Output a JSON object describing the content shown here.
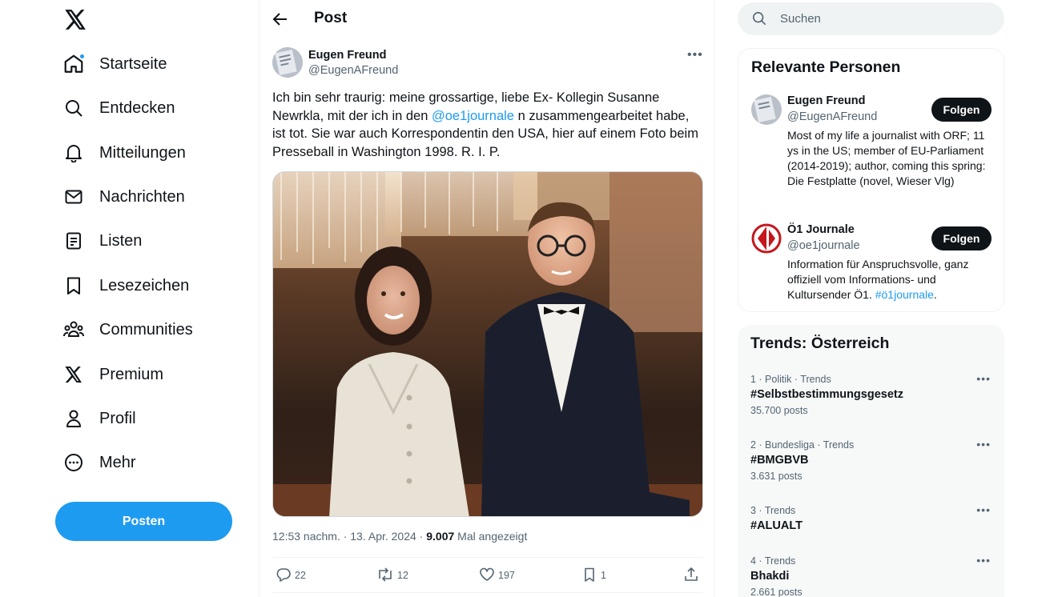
{
  "nav": {
    "items": [
      {
        "label": "Startseite",
        "icon": "home-icon"
      },
      {
        "label": "Entdecken",
        "icon": "search-icon"
      },
      {
        "label": "Mitteilungen",
        "icon": "bell-icon"
      },
      {
        "label": "Nachrichten",
        "icon": "mail-icon"
      },
      {
        "label": "Listen",
        "icon": "list-icon"
      },
      {
        "label": "Lesezeichen",
        "icon": "bookmark-icon"
      },
      {
        "label": "Communities",
        "icon": "people-icon"
      },
      {
        "label": "Premium",
        "icon": "x-logo-icon"
      },
      {
        "label": "Profil",
        "icon": "person-icon"
      },
      {
        "label": "Mehr",
        "icon": "more-circle-icon"
      }
    ],
    "post_button": "Posten"
  },
  "header": {
    "title": "Post"
  },
  "post": {
    "author_name": "Eugen Freund",
    "author_handle": "@EugenAFreund",
    "text_before": "Ich bin sehr traurig: meine grossartige, liebe Ex- Kollegin Susanne Newrkla, mit der ich in den ",
    "mention": "@oe1journale",
    "text_after": " n zusammengearbeitet habe, ist tot. Sie war auch Korrespondentin den USA, hier auf einem Foto beim Presseball in Washington 1998. R. I. P.",
    "time": "12:53 nachm. · 13. Apr. 2024 · ",
    "views": "9.007",
    "views_label": " Mal angezeigt",
    "replies": "22",
    "reposts": "12",
    "likes": "197",
    "bookmarks": "1"
  },
  "search": {
    "placeholder": "Suchen"
  },
  "relevant": {
    "title": "Relevante Personen",
    "people": [
      {
        "name": "Eugen Freund",
        "handle": "@EugenAFreund",
        "bio": "Most of my life a journalist with ORF; 11 ys in the US; member of EU-Parliament (2014-2019); author, coming this spring: Die Festplatte (novel, Wieser Vlg)",
        "follow": "Folgen"
      },
      {
        "name": "Ö1 Journale",
        "handle": "@oe1journale",
        "bio_before": "Information für Anspruchsvolle, ganz offiziell vom Informations- und Kultursender Ö1. ",
        "bio_tag": "#ö1journale",
        "bio_after": ".",
        "follow": "Folgen"
      }
    ]
  },
  "trends": {
    "title": "Trends: Österreich",
    "items": [
      {
        "meta": "1 · Politik · Trends",
        "name": "#Selbstbestimmungsgesetz",
        "count": "35.700 posts"
      },
      {
        "meta": "2 · Bundesliga · Trends",
        "name": "#BMGBVB",
        "count": "3.631 posts"
      },
      {
        "meta": "3 · Trends",
        "name": "#ALUALT",
        "count": ""
      },
      {
        "meta": "4 · Trends",
        "name": "Bhakdi",
        "count": "2.661 posts"
      }
    ]
  },
  "colors": {
    "accent": "#1d9bf0",
    "text": "#0f1419",
    "muted": "#536471",
    "follow_button": "#0f1419"
  }
}
